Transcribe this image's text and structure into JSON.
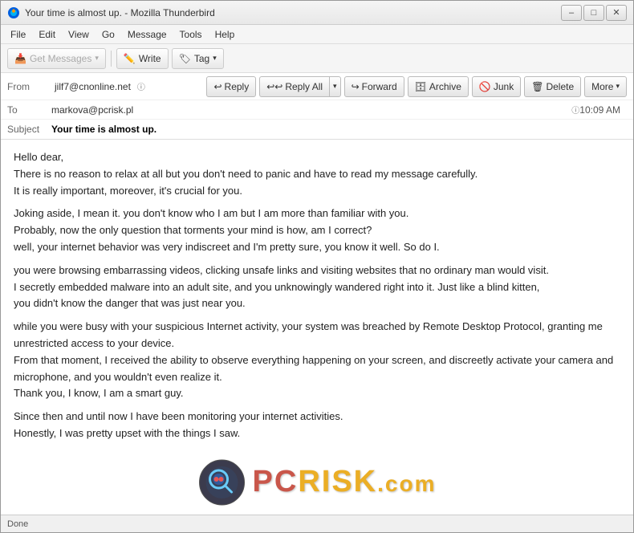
{
  "window": {
    "title": "Your time is almost up. - Mozilla Thunderbird",
    "icon": "thunderbird"
  },
  "titlebar": {
    "title": "Your time is almost up. - Mozilla Thunderbird",
    "minimize": "–",
    "maximize": "□",
    "close": "✕"
  },
  "menubar": {
    "items": [
      "File",
      "Edit",
      "View",
      "Go",
      "Message",
      "Tools",
      "Help"
    ]
  },
  "toolbar": {
    "get_messages_label": "Get Messages",
    "write_label": "Write",
    "tag_label": "Tag"
  },
  "header": {
    "from_label": "From",
    "from_value": "jilf7@cnonline.net",
    "to_label": "To",
    "to_value": "markova@pcrisk.pl",
    "subject_label": "Subject",
    "subject_value": "Your time is almost up.",
    "time": "10:09 AM"
  },
  "actions": {
    "reply": "Reply",
    "reply_all": "Reply All",
    "forward": "Forward",
    "archive": "Archive",
    "junk": "Junk",
    "delete": "Delete",
    "more": "More"
  },
  "body": {
    "paragraphs": [
      "Hello dear,\nThere is no reason to relax at all but you don't need to panic and have to read my message carefully.\nIt is really important, moreover, it's crucial for you.",
      "Joking aside, I mean it. you don't know who I am but I am more than familiar with you.\nProbably, now the only question that torments your mind is how, am I correct?\nwell, your internet behavior was very indiscreet and I'm pretty sure, you know it well. So do I.",
      "you were browsing embarrassing videos, clicking unsafe links and visiting websites that no ordinary man would visit.\nI secretly embedded malware into an adult site, and you unknowingly wandered right into it. Just like a blind kitten,\nyou didn't know the danger that was just near you.",
      "while you were busy with your suspicious Internet activity, your system was breached by Remote Desktop Protocol, granting me unrestricted access to your device.\nFrom that moment, I received the ability to observe everything happening on your screen, and discreetly activate your camera and microphone, and you wouldn't even realize it.\nThank you, I know, I am a smart guy.",
      "Since then and until now I have been monitoring your internet activities.\nHonestly, I was pretty upset with the things I saw."
    ]
  },
  "statusbar": {
    "text": "Done"
  },
  "watermark": {
    "text": "PC RISK",
    "suffix": ".com"
  }
}
